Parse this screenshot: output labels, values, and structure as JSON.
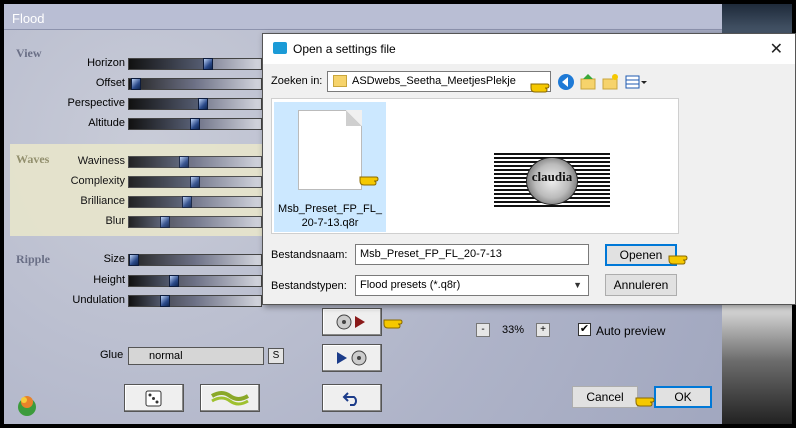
{
  "app": {
    "title": "Flood"
  },
  "sections": [
    {
      "name": "View",
      "rows": [
        {
          "label": "Horizon",
          "value": 0.6
        },
        {
          "label": "Offset",
          "value": 0.05
        },
        {
          "label": "Perspective",
          "value": 0.56
        },
        {
          "label": "Altitude",
          "value": 0.5
        }
      ]
    },
    {
      "name": "Waves",
      "rows": [
        {
          "label": "Waviness",
          "value": 0.42
        },
        {
          "label": "Complexity",
          "value": 0.5
        },
        {
          "label": "Brilliance",
          "value": 0.44
        },
        {
          "label": "Blur",
          "value": 0.27
        }
      ]
    },
    {
      "name": "Ripple",
      "rows": [
        {
          "label": "Size",
          "value": 0.04
        },
        {
          "label": "Height",
          "value": 0.34
        },
        {
          "label": "Undulation",
          "value": 0.27
        }
      ]
    }
  ],
  "glue": {
    "label": "Glue",
    "value": "normal",
    "s_label": "S"
  },
  "zoom": {
    "minus": "-",
    "value": "33%",
    "plus": "+"
  },
  "preview": {
    "label": "Auto preview",
    "checked": "✔"
  },
  "buttons": {
    "cancel": "Cancel",
    "ok": "OK"
  },
  "dialog": {
    "title": "Open a settings file",
    "close": "✕",
    "zoek_label": "Zoeken in:",
    "folder": "ASDwebs_Seetha_MeetjesPlekje",
    "file_name_display": "Msb_Preset_FP_FL_20-7-13.q8r",
    "preview_text": "claudia",
    "bestandsnaam_label": "Bestandsnaam:",
    "bestandsnaam_value": "Msb_Preset_FP_FL_20-7-13",
    "bestandstypen_label": "Bestandstypen:",
    "bestandstypen_value": "Flood presets (*.q8r)",
    "open_label": "Openen",
    "cancel_label": "Annuleren"
  },
  "colors": {
    "accent": "#0078d7",
    "hand": "#f5c800"
  }
}
